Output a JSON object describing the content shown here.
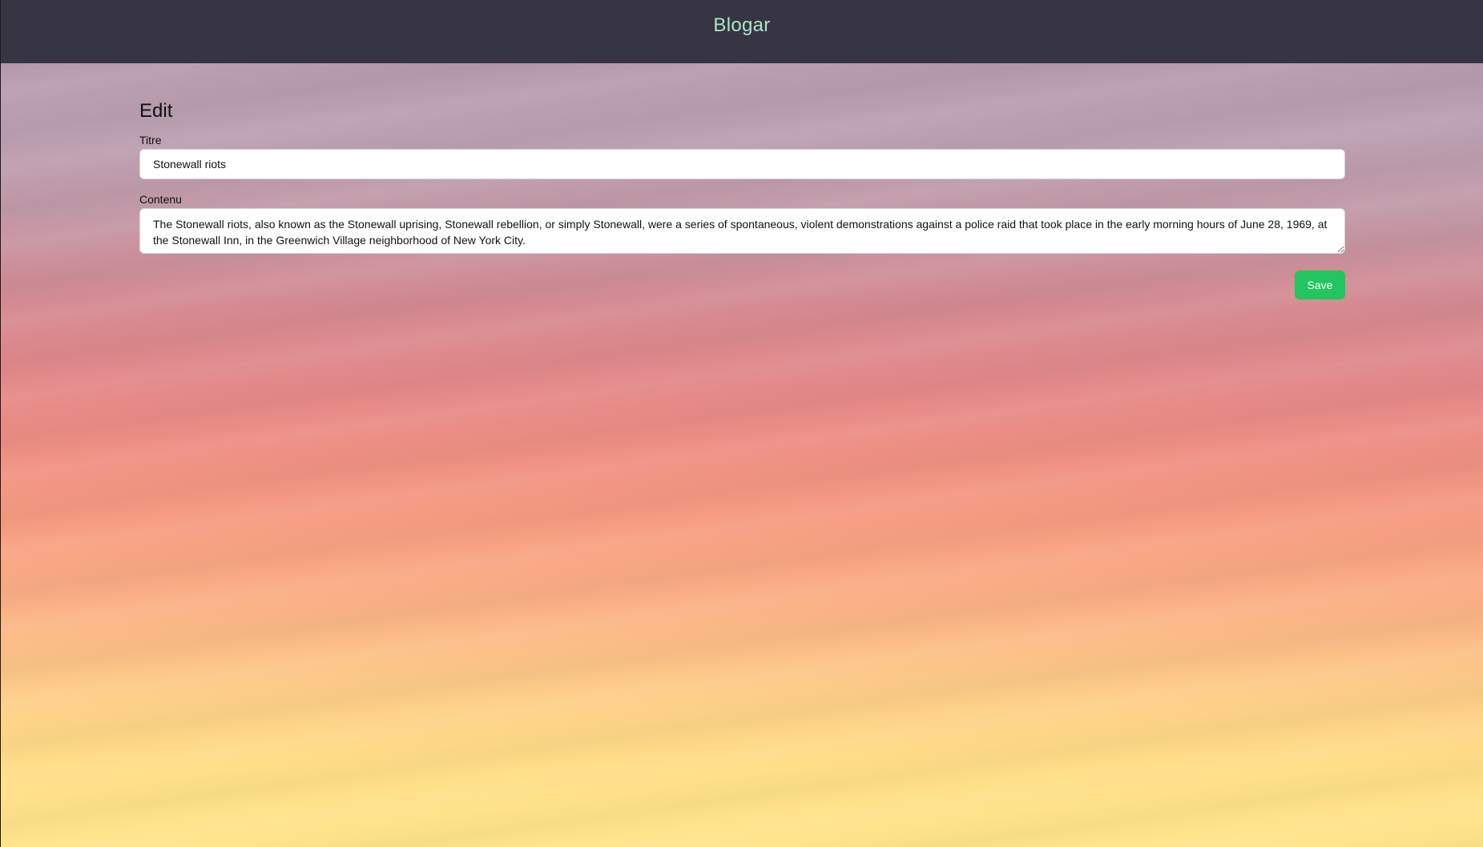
{
  "header": {
    "brand": "Blogar"
  },
  "form": {
    "heading": "Edit",
    "title_label": "Titre",
    "title_value": "Stonewall riots",
    "content_label": "Contenu",
    "content_value": "The Stonewall riots, also known as the Stonewall uprising, Stonewall rebellion, or simply Stonewall, were a series of spontaneous, violent demonstrations against a police raid that took place in the early morning hours of June 28, 1969, at the Stonewall Inn, in the Greenwich Village neighborhood of New York City.",
    "save_label": "Save"
  },
  "colors": {
    "header_bg": "#373444",
    "brand_text": "#a9e8c6",
    "save_button": "#22c55e"
  }
}
